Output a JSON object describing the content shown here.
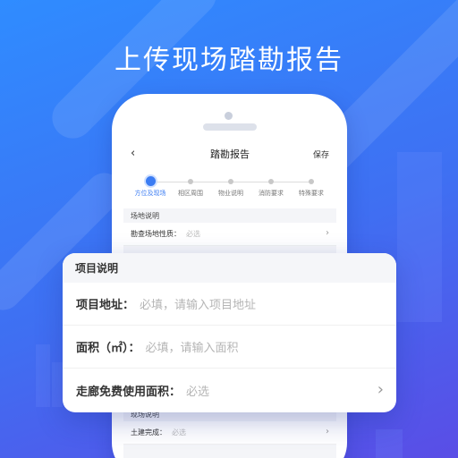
{
  "headline": "上传现场踏勘报告",
  "screen": {
    "nav": {
      "back_icon": "‹",
      "title": "踏勘报告",
      "save_label": "保存"
    },
    "steps": [
      "方位及现场",
      "相区周围",
      "物业说明",
      "消防要求",
      "特殊要求"
    ],
    "active_step": 0,
    "site_section": {
      "label": "场地说明",
      "rows": [
        {
          "key": "勘查场地性质：",
          "value": "必选"
        }
      ]
    },
    "lower_section": {
      "label": "现场说明",
      "rows": [
        {
          "key": "土建完成：",
          "value": "必选"
        }
      ]
    }
  },
  "card": {
    "header": "项目说明",
    "rows": [
      {
        "key": "项目地址：",
        "placeholder": "必填，请输入项目地址"
      },
      {
        "key": "面积（㎡）：",
        "placeholder": "必填，请输入面积"
      },
      {
        "key": "走廊免费使用面积：",
        "value": "必选",
        "chevron": "›"
      }
    ]
  },
  "colors": {
    "accent": "#3b7cf3",
    "background_top": "#2f8cff",
    "background_bottom": "#5a4de6"
  }
}
